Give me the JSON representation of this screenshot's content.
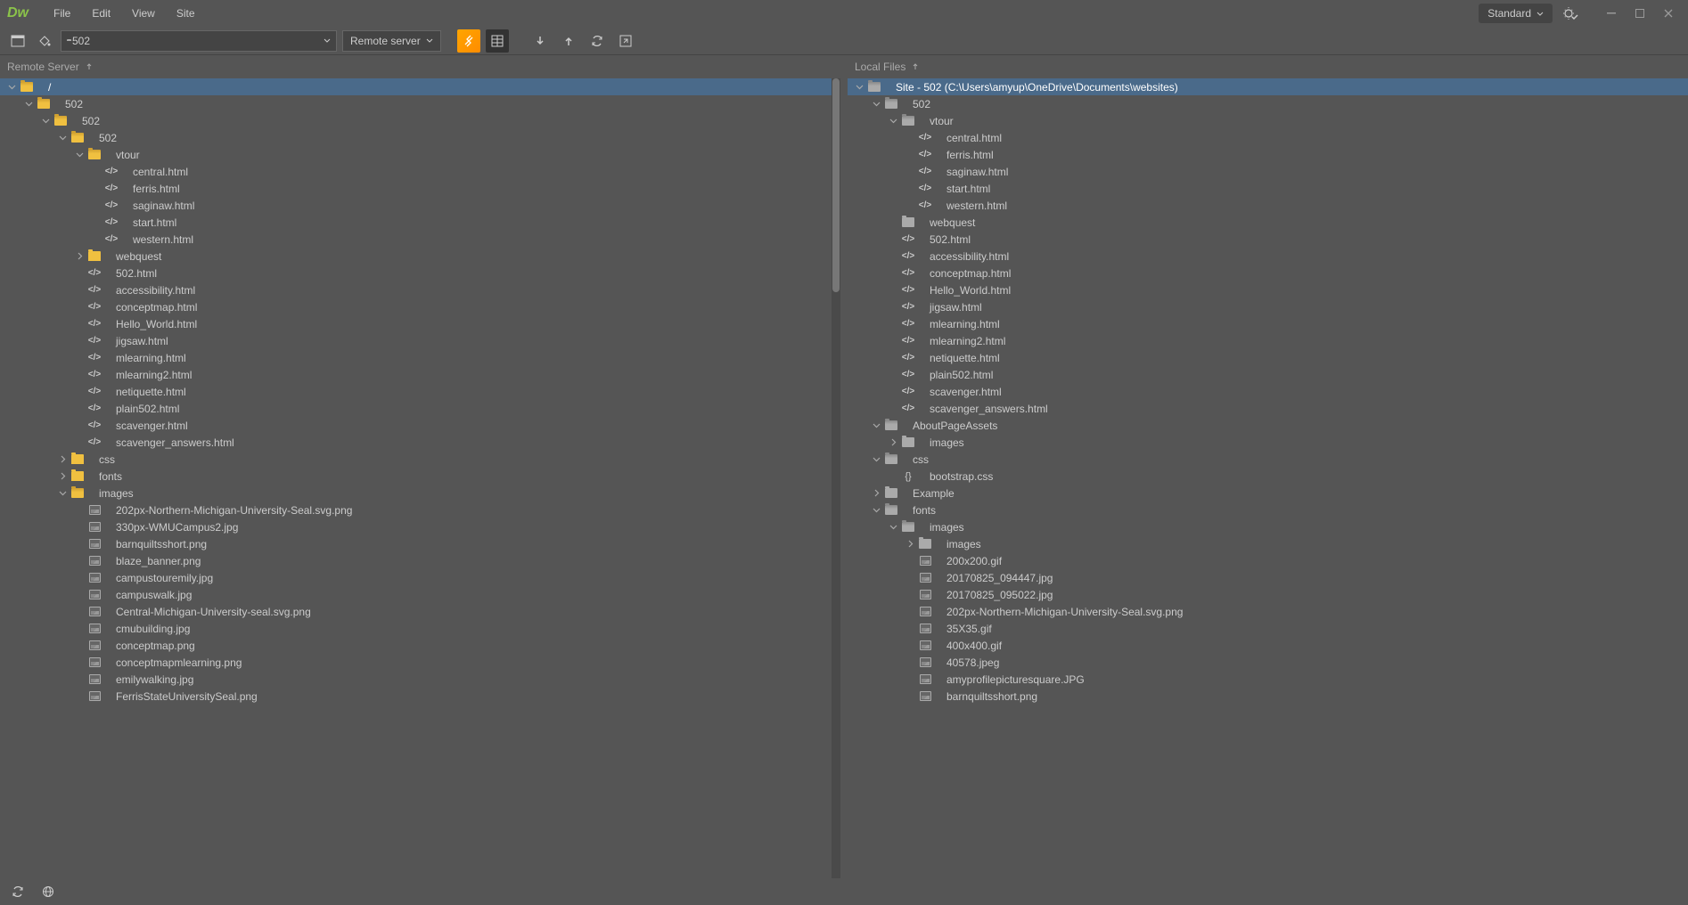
{
  "menu": {
    "items": [
      "File",
      "Edit",
      "View",
      "Site"
    ],
    "workspace": "Standard"
  },
  "toolbar": {
    "site": "502",
    "server": "Remote server"
  },
  "remote": {
    "title": "Remote Server",
    "root": "/",
    "tree": [
      {
        "d": 0,
        "t": "chev-d",
        "i": "fo-y",
        "n": "/",
        "sel": true
      },
      {
        "d": 1,
        "t": "chev-d",
        "i": "fo-y",
        "n": "502"
      },
      {
        "d": 2,
        "t": "chev-d",
        "i": "fo-y",
        "n": "502"
      },
      {
        "d": 3,
        "t": "chev-d",
        "i": "fo-y",
        "n": "502"
      },
      {
        "d": 4,
        "t": "chev-d",
        "i": "fo-y",
        "n": "vtour"
      },
      {
        "d": 5,
        "t": "",
        "i": "code",
        "n": "central.html"
      },
      {
        "d": 5,
        "t": "",
        "i": "code",
        "n": "ferris.html"
      },
      {
        "d": 5,
        "t": "",
        "i": "code",
        "n": "saginaw.html"
      },
      {
        "d": 5,
        "t": "",
        "i": "code",
        "n": "start.html"
      },
      {
        "d": 5,
        "t": "",
        "i": "code",
        "n": "western.html"
      },
      {
        "d": 4,
        "t": "chev-r",
        "i": "f-y",
        "n": "webquest"
      },
      {
        "d": 4,
        "t": "",
        "i": "code",
        "n": "502.html"
      },
      {
        "d": 4,
        "t": "",
        "i": "code",
        "n": "accessibility.html"
      },
      {
        "d": 4,
        "t": "",
        "i": "code",
        "n": "conceptmap.html"
      },
      {
        "d": 4,
        "t": "",
        "i": "code",
        "n": "Hello_World.html"
      },
      {
        "d": 4,
        "t": "",
        "i": "code",
        "n": "jigsaw.html"
      },
      {
        "d": 4,
        "t": "",
        "i": "code",
        "n": "mlearning.html"
      },
      {
        "d": 4,
        "t": "",
        "i": "code",
        "n": "mlearning2.html"
      },
      {
        "d": 4,
        "t": "",
        "i": "code",
        "n": "netiquette.html"
      },
      {
        "d": 4,
        "t": "",
        "i": "code",
        "n": "plain502.html"
      },
      {
        "d": 4,
        "t": "",
        "i": "code",
        "n": "scavenger.html"
      },
      {
        "d": 4,
        "t": "",
        "i": "code",
        "n": "scavenger_answers.html"
      },
      {
        "d": 3,
        "t": "chev-r",
        "i": "f-y",
        "n": "css"
      },
      {
        "d": 3,
        "t": "chev-r",
        "i": "f-y",
        "n": "fonts"
      },
      {
        "d": 3,
        "t": "chev-d",
        "i": "fo-y",
        "n": "images"
      },
      {
        "d": 4,
        "t": "",
        "i": "img",
        "n": "202px-Northern-Michigan-University-Seal.svg.png"
      },
      {
        "d": 4,
        "t": "",
        "i": "img",
        "n": "330px-WMUCampus2.jpg"
      },
      {
        "d": 4,
        "t": "",
        "i": "img",
        "n": "barnquiltsshort.png"
      },
      {
        "d": 4,
        "t": "",
        "i": "img",
        "n": "blaze_banner.png"
      },
      {
        "d": 4,
        "t": "",
        "i": "img",
        "n": "campustouremily.jpg"
      },
      {
        "d": 4,
        "t": "",
        "i": "img",
        "n": "campuswalk.jpg"
      },
      {
        "d": 4,
        "t": "",
        "i": "img",
        "n": "Central-Michigan-University-seal.svg.png"
      },
      {
        "d": 4,
        "t": "",
        "i": "img",
        "n": "cmubuilding.jpg"
      },
      {
        "d": 4,
        "t": "",
        "i": "img",
        "n": "conceptmap.png"
      },
      {
        "d": 4,
        "t": "",
        "i": "img",
        "n": "conceptmapmlearning.png"
      },
      {
        "d": 4,
        "t": "",
        "i": "img",
        "n": "emilywalking.jpg"
      },
      {
        "d": 4,
        "t": "",
        "i": "img",
        "n": "FerrisStateUniversitySeal.png"
      }
    ]
  },
  "local": {
    "title": "Local Files",
    "root": "Site - 502 (C:\\Users\\amyup\\OneDrive\\Documents\\websites)",
    "tree": [
      {
        "d": 0,
        "t": "chev-d",
        "i": "fo-g",
        "n": "Site - 502 (C:\\Users\\amyup\\OneDrive\\Documents\\websites)",
        "sel": true
      },
      {
        "d": 1,
        "t": "chev-d",
        "i": "fo-g",
        "n": "502"
      },
      {
        "d": 2,
        "t": "chev-d",
        "i": "fo-g",
        "n": "vtour"
      },
      {
        "d": 3,
        "t": "",
        "i": "code",
        "n": "central.html"
      },
      {
        "d": 3,
        "t": "",
        "i": "code",
        "n": "ferris.html"
      },
      {
        "d": 3,
        "t": "",
        "i": "code",
        "n": "saginaw.html"
      },
      {
        "d": 3,
        "t": "",
        "i": "code",
        "n": "start.html"
      },
      {
        "d": 3,
        "t": "",
        "i": "code",
        "n": "western.html"
      },
      {
        "d": 2,
        "t": "",
        "i": "f-g",
        "n": "webquest"
      },
      {
        "d": 2,
        "t": "",
        "i": "code",
        "n": "502.html"
      },
      {
        "d": 2,
        "t": "",
        "i": "code",
        "n": "accessibility.html"
      },
      {
        "d": 2,
        "t": "",
        "i": "code",
        "n": "conceptmap.html"
      },
      {
        "d": 2,
        "t": "",
        "i": "code",
        "n": "Hello_World.html"
      },
      {
        "d": 2,
        "t": "",
        "i": "code",
        "n": "jigsaw.html"
      },
      {
        "d": 2,
        "t": "",
        "i": "code",
        "n": "mlearning.html"
      },
      {
        "d": 2,
        "t": "",
        "i": "code",
        "n": "mlearning2.html"
      },
      {
        "d": 2,
        "t": "",
        "i": "code",
        "n": "netiquette.html"
      },
      {
        "d": 2,
        "t": "",
        "i": "code",
        "n": "plain502.html"
      },
      {
        "d": 2,
        "t": "",
        "i": "code",
        "n": "scavenger.html"
      },
      {
        "d": 2,
        "t": "",
        "i": "code",
        "n": "scavenger_answers.html"
      },
      {
        "d": 1,
        "t": "chev-d",
        "i": "fo-g",
        "n": "AboutPageAssets"
      },
      {
        "d": 2,
        "t": "chev-r",
        "i": "f-g",
        "n": "images"
      },
      {
        "d": 1,
        "t": "chev-d",
        "i": "fo-g",
        "n": "css"
      },
      {
        "d": 2,
        "t": "",
        "i": "css",
        "n": "bootstrap.css"
      },
      {
        "d": 1,
        "t": "chev-r",
        "i": "f-g",
        "n": "Example"
      },
      {
        "d": 1,
        "t": "chev-d",
        "i": "fo-g",
        "n": "fonts"
      },
      {
        "d": 2,
        "t": "chev-d",
        "i": "fo-g",
        "n": "images"
      },
      {
        "d": 3,
        "t": "chev-r",
        "i": "f-g",
        "n": "images"
      },
      {
        "d": 3,
        "t": "",
        "i": "img",
        "n": "200x200.gif"
      },
      {
        "d": 3,
        "t": "",
        "i": "img",
        "n": "20170825_094447.jpg"
      },
      {
        "d": 3,
        "t": "",
        "i": "img",
        "n": "20170825_095022.jpg"
      },
      {
        "d": 3,
        "t": "",
        "i": "img",
        "n": "202px-Northern-Michigan-University-Seal.svg.png"
      },
      {
        "d": 3,
        "t": "",
        "i": "img",
        "n": "35X35.gif"
      },
      {
        "d": 3,
        "t": "",
        "i": "img",
        "n": "400x400.gif"
      },
      {
        "d": 3,
        "t": "",
        "i": "img",
        "n": "40578.jpeg"
      },
      {
        "d": 3,
        "t": "",
        "i": "img",
        "n": "amyprofilepicturesquare.JPG"
      },
      {
        "d": 3,
        "t": "",
        "i": "img",
        "n": "barnquiltsshort.png"
      }
    ]
  }
}
